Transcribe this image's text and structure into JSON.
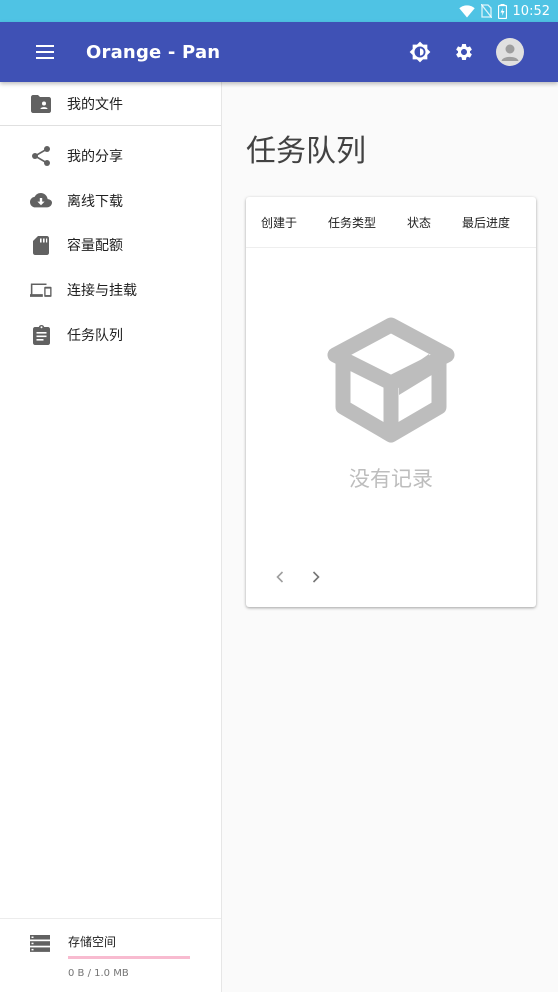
{
  "status_bar": {
    "time": "10:52"
  },
  "app_bar": {
    "title": "Orange - Pan"
  },
  "sidebar": {
    "primary": {
      "label": "我的文件"
    },
    "items": [
      {
        "label": "我的分享",
        "icon": "share-icon"
      },
      {
        "label": "离线下载",
        "icon": "cloud-download-icon"
      },
      {
        "label": "容量配额",
        "icon": "sd-card-icon"
      },
      {
        "label": "连接与挂载",
        "icon": "devices-icon"
      },
      {
        "label": "任务队列",
        "icon": "clipboard-list-icon"
      }
    ],
    "storage": {
      "label": "存储空间",
      "usage": "0 B / 1.0 MB",
      "used_fraction": 0
    }
  },
  "main": {
    "title": "任务队列",
    "table": {
      "columns": [
        "创建于",
        "任务类型",
        "状态",
        "最后进度"
      ],
      "rows": []
    },
    "empty_text": "没有记录"
  },
  "colors": {
    "status_bar": "#4fc3e4",
    "app_bar": "#3f51b5",
    "storage_track": "#f8bbd0"
  }
}
